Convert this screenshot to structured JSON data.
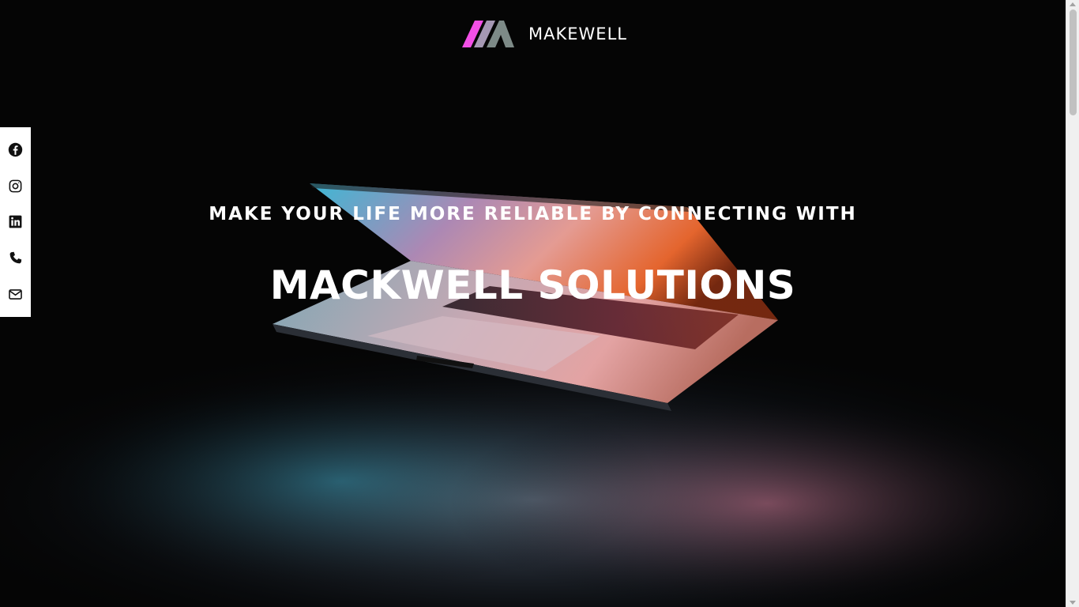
{
  "site": {
    "brand": "MAKEWELL",
    "logo_colors": {
      "pink": "#f24fe6",
      "gray": "#7d8a87"
    }
  },
  "hero": {
    "tagline": "MAKE YOUR LIFE MORE RELIABLE BY CONNECTING WITH",
    "headline": "MACKWELL SOLUTIONS",
    "background_image": "laptop-glow-photo"
  },
  "social_bar": {
    "items": [
      {
        "icon": "facebook-icon"
      },
      {
        "icon": "instagram-icon"
      },
      {
        "icon": "linkedin-icon"
      },
      {
        "icon": "phone-icon"
      },
      {
        "icon": "mail-icon"
      }
    ]
  },
  "colors": {
    "text": "#ffffff",
    "background": "#000000",
    "social_bar_bg": "#ffffff",
    "icon": "#111111"
  }
}
